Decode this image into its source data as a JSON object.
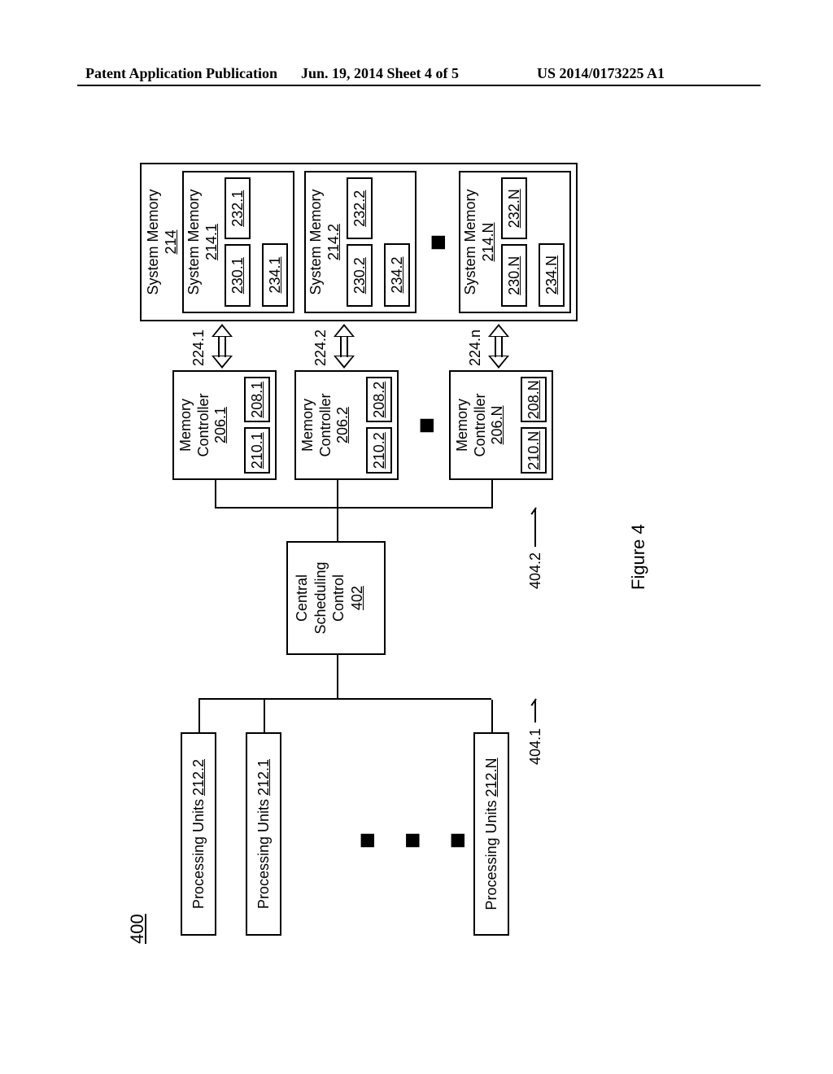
{
  "header": {
    "left": "Patent Application Publication",
    "mid": "Jun. 19, 2014  Sheet 4 of 5",
    "right": "US 2014/0173225 A1"
  },
  "figure": {
    "ref": "400",
    "caption": "Figure 4",
    "pu": {
      "p1": "Processing Units",
      "p1_ref": "212.2",
      "p2": "Processing Units",
      "p2_ref": "212.1",
      "pN": "Processing Units",
      "pN_ref": "212.N"
    },
    "csc": {
      "l1": "Central",
      "l2": "Scheduling",
      "l3": "Control",
      "ref": "402"
    },
    "bus": {
      "left": "404.1",
      "right": "404.2"
    },
    "mc": {
      "title": "Memory",
      "title2": "Controller",
      "m1_ref": "206.1",
      "m1_a": "210.1",
      "m1_b": "208.1",
      "m2_ref": "206.2",
      "m2_a": "210.2",
      "m2_b": "208.2",
      "mN_ref": "206.N",
      "mN_a": "210.N",
      "mN_b": "208.N"
    },
    "arrows": {
      "a1": "224.1",
      "a2": "224.2",
      "aN": "224.n"
    },
    "sys": {
      "outer_title": "System Memory",
      "outer_ref": "214",
      "s1_title": "System Memory",
      "s1_ref": "214.1",
      "s1_a": "230.1",
      "s1_b": "232.1",
      "s1_c": "234.1",
      "s2_title": "System Memory",
      "s2_ref": "214.2",
      "s2_a": "230.2",
      "s2_b": "232.2",
      "s2_c": "234.2",
      "sN_title": "System Memory",
      "sN_ref": "214.N",
      "sN_a": "230.N",
      "sN_b": "232.N",
      "sN_c": "234.N"
    },
    "dots": "■ ■ ■"
  }
}
